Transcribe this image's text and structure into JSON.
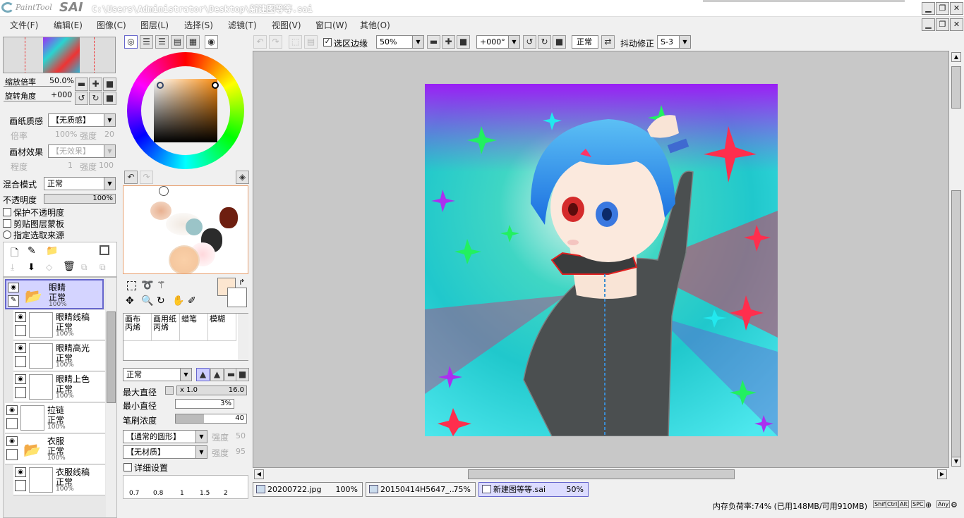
{
  "app": {
    "logo_text": "PaintTool",
    "logo_brand": "SAI",
    "title": "C:\\Users\\Administrator\\Desktop\\新建图等等.sai"
  },
  "menu": [
    "文件(F)",
    "编辑(E)",
    "图像(C)",
    "图层(L)",
    "选择(S)",
    "滤镜(T)",
    "视图(V)",
    "窗口(W)",
    "其他(O)"
  ],
  "toolbar": {
    "show_selection_label": "选区边缘",
    "zoom": "50%",
    "rotation": "+000°",
    "mode": "正常",
    "stabilizer_label": "抖动修正",
    "stabilizer": "S-3"
  },
  "navigator": {
    "zoom_label": "缩放倍率",
    "zoom_value": "50.0%",
    "rotate_label": "旋转角度",
    "rotate_value": "+000"
  },
  "paper": {
    "texture_label": "画纸质感",
    "texture": "【无质感】",
    "scale_label": "倍率",
    "scale_value": "100%",
    "strength_label": "强度",
    "strength_value": "20",
    "effect_label": "画材效果",
    "effect": "【无效果】",
    "degree_label": "程度",
    "degree_value": "1",
    "strength2_value": "100"
  },
  "blend": {
    "label": "混合模式",
    "value": "正常",
    "opacity_label": "不透明度",
    "opacity": "100%",
    "preserve": "保护不透明度",
    "clip": "剪贴图层蒙板",
    "source": "指定选取来源"
  },
  "layers": [
    {
      "name": "眼睛",
      "mode": "正常",
      "opacity": "100%",
      "folder": true,
      "selected": true
    },
    {
      "name": "眼睛线稿",
      "mode": "正常",
      "opacity": "100%"
    },
    {
      "name": "眼睛高光",
      "mode": "正常",
      "opacity": "100%"
    },
    {
      "name": "眼睛上色",
      "mode": "正常",
      "opacity": "100%"
    },
    {
      "name": "拉链",
      "mode": "正常",
      "opacity": "100%"
    },
    {
      "name": "衣服",
      "mode": "正常",
      "opacity": "100%",
      "folder": true
    },
    {
      "name": "衣服线稿",
      "mode": "正常",
      "opacity": "100%"
    }
  ],
  "brushes": [
    {
      "l1": "画布",
      "l2": "丙烯"
    },
    {
      "l1": "画用纸",
      "l2": "丙烯"
    },
    {
      "l1": "蜡笔",
      "l2": ""
    },
    {
      "l1": "模糊",
      "l2": ""
    }
  ],
  "brush": {
    "mode": "正常",
    "max_label": "最大直径",
    "max_mult": "x 1.0",
    "max_value": "16.0",
    "min_label": "最小直径",
    "min_value": "3%",
    "density_label": "笔刷浓度",
    "density_value": "40",
    "shape": "【通常的圆形】",
    "shape_strength_label": "强度",
    "shape_strength": "50",
    "texture": "【无材质】",
    "tex_strength": "95",
    "detail_label": "详细设置",
    "sizes": [
      "0.7",
      "0.8",
      "1",
      "1.5",
      "2"
    ]
  },
  "tabs": [
    {
      "name": "20200722.jpg",
      "pct": "100%"
    },
    {
      "name": "20150414H5647_...",
      "pct": "75%"
    },
    {
      "name": "新建图等等.sai",
      "pct": "50%"
    }
  ],
  "status": "内存负荷率:74% (已用148MB/可用910MB)",
  "keys": [
    "Shift",
    "Ctrl",
    "Alt",
    "SPC",
    "Any"
  ]
}
